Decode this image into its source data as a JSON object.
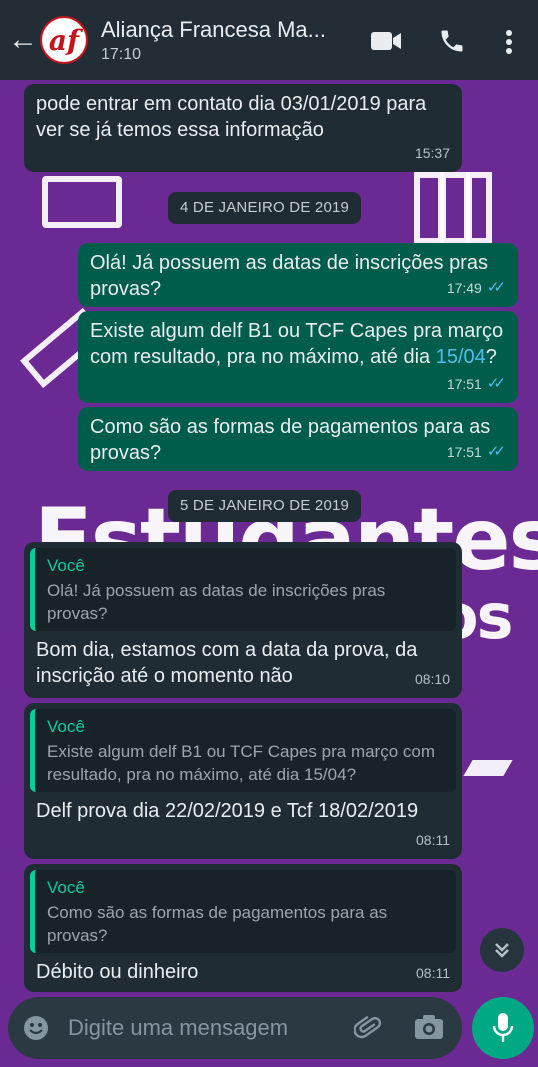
{
  "header": {
    "back_icon": "arrow-left-icon",
    "avatar_text": "af",
    "title": "Aliança Francesa Ma...",
    "subtitle": "17:10",
    "icons": [
      "video-call-icon",
      "phone-icon",
      "more-vert-icon"
    ]
  },
  "messages": [
    {
      "dir": "in",
      "text": "pode entrar em contato dia 03/01/2019 para ver se já temos essa informação",
      "time": "15:37"
    },
    {
      "date": "4 DE JANEIRO DE 2019"
    },
    {
      "dir": "out",
      "text": "Olá! Já possuem as datas de inscrições pras provas?",
      "time": "17:49"
    },
    {
      "dir": "out",
      "text_before": "Existe algum delf B1 ou TCF Capes pra março com resultado, pra no máximo, até dia ",
      "text_link": "15/04",
      "text_after": "?",
      "time": "17:51"
    },
    {
      "dir": "out",
      "text": "Como são as formas de pagamentos para as provas?",
      "time": "17:51"
    },
    {
      "date": "5 DE JANEIRO DE 2019"
    },
    {
      "dir": "in",
      "quote_author": "Você",
      "quote_text": "Olá! Já possuem as datas de inscrições pras provas?",
      "text": "Bom dia,  estamos com a data da prova, da inscrição até o momento não",
      "time": "08:10"
    },
    {
      "dir": "in",
      "quote_author": "Você",
      "quote_text": "Existe algum delf B1 ou TCF Capes pra março com resultado, pra no máximo, até dia 15/04?",
      "text": "Delf prova dia 22/02/2019  e Tcf 18/02/2019",
      "time": "08:11"
    },
    {
      "dir": "in",
      "quote_author": "Você",
      "quote_text": "Como são as formas de pagamentos para as provas?",
      "text": "Débito ou dinheiro",
      "time": "08:11"
    }
  ],
  "wallpaper_text": [
    "Estudantes",
    "os"
  ],
  "input": {
    "placeholder": "Digite uma mensagem",
    "emoji_icon": "emoji-icon",
    "attach_icon": "paperclip-icon",
    "camera_icon": "camera-icon",
    "mic_icon": "mic-icon",
    "scroll_icon": "chevron-double-down-icon"
  },
  "colors": {
    "wallpaper": "#6b2a93",
    "header": "#232d36",
    "incoming": "#1f2c34",
    "outgoing": "#005c4b",
    "accent": "#00a884",
    "read_ticks": "#53bdeb"
  }
}
